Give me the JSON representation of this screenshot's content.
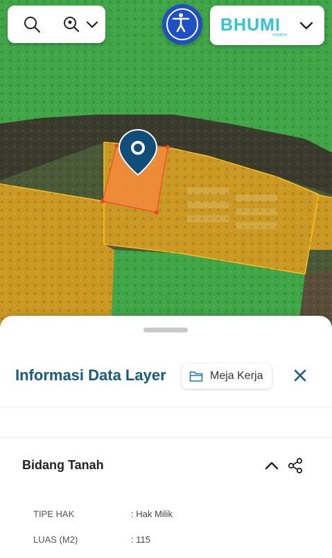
{
  "toolbar": {
    "search_icon": "search-icon",
    "zoom_icon": "zoom-location-icon",
    "dropdown_icon": "chevron-down-icon"
  },
  "accessibility": {
    "icon": "accessibility-icon"
  },
  "brand": {
    "logo_text": "BHUMI",
    "subtext": "ATR/BPN"
  },
  "map": {
    "colors": {
      "green": "#3fae4a",
      "yellow": "#e2a81c",
      "selected": "#f08a3a",
      "pin": "#0f4d7a"
    },
    "pin_icon": "map-pin-icon"
  },
  "panel": {
    "title": "Informasi Data Layer",
    "workspace_button": "Meja Kerja",
    "section": {
      "title": "Bidang Tanah",
      "fields": [
        {
          "label": "TIPE HAK",
          "value": ": Hak Milik"
        },
        {
          "label": "LUAS (M2)",
          "value": ": 115"
        }
      ]
    }
  },
  "colors": {
    "accent": "#175a82",
    "a11y_bg": "#1f4fc6",
    "brand": "#2dc4d6"
  }
}
